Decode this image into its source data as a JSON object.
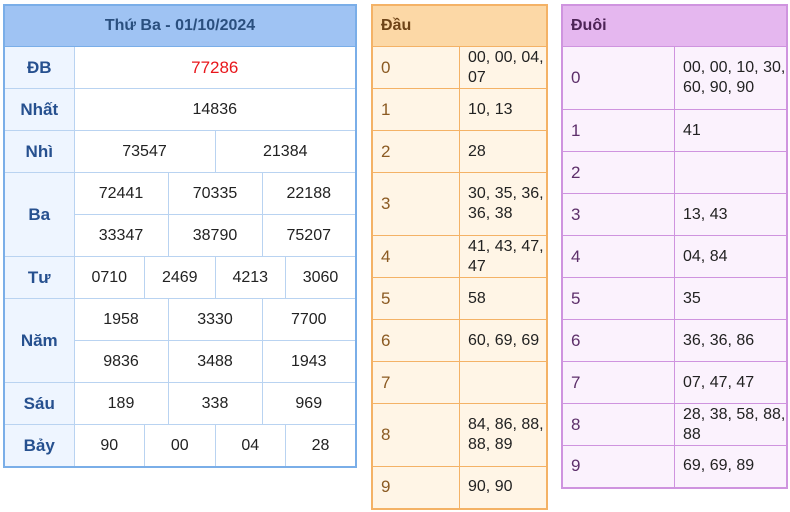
{
  "results": {
    "header": "Thứ Ba - 01/10/2024",
    "db_label": "ĐB",
    "db": "77286",
    "nhat_label": "Nhất",
    "nhat": "14836",
    "nhi_label": "Nhì",
    "nhi": [
      "73547",
      "21384"
    ],
    "ba_label": "Ba",
    "ba": [
      "72441",
      "70335",
      "22188",
      "33347",
      "38790",
      "75207"
    ],
    "tu_label": "Tư",
    "tu": [
      "0710",
      "2469",
      "4213",
      "3060"
    ],
    "nam_label": "Năm",
    "nam": [
      "1958",
      "3330",
      "7700",
      "9836",
      "3488",
      "1943"
    ],
    "sau_label": "Sáu",
    "sau": [
      "189",
      "338",
      "969"
    ],
    "bay_label": "Bảy",
    "bay": [
      "90",
      "00",
      "04",
      "28"
    ]
  },
  "dau": {
    "header": "Đầu",
    "rows": [
      {
        "key": "0",
        "vals": "00, 00, 04, 07"
      },
      {
        "key": "1",
        "vals": "10, 13"
      },
      {
        "key": "2",
        "vals": "28"
      },
      {
        "key": "3",
        "vals": "30, 35, 36, 36, 38"
      },
      {
        "key": "4",
        "vals": "41, 43, 47, 47"
      },
      {
        "key": "5",
        "vals": "58"
      },
      {
        "key": "6",
        "vals": "60, 69, 69"
      },
      {
        "key": "7",
        "vals": ""
      },
      {
        "key": "8",
        "vals": "84, 86, 88, 88, 89"
      },
      {
        "key": "9",
        "vals": "90, 90"
      }
    ]
  },
  "duoi": {
    "header": "Đuôi",
    "rows": [
      {
        "key": "0",
        "vals": "00, 00, 10, 30, 60, 90, 90"
      },
      {
        "key": "1",
        "vals": "41"
      },
      {
        "key": "2",
        "vals": ""
      },
      {
        "key": "3",
        "vals": "13, 43"
      },
      {
        "key": "4",
        "vals": "04, 84"
      },
      {
        "key": "5",
        "vals": "35"
      },
      {
        "key": "6",
        "vals": "36, 36, 86"
      },
      {
        "key": "7",
        "vals": "07, 47, 47"
      },
      {
        "key": "8",
        "vals": "28, 38, 58, 88, 88"
      },
      {
        "key": "9",
        "vals": "69, 69, 89"
      }
    ]
  }
}
